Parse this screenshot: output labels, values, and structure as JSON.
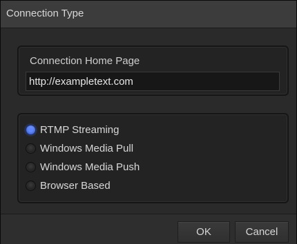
{
  "dialog": {
    "title": "Connection Type"
  },
  "home_page": {
    "label": "Connection Home Page",
    "url_value": "http://exampletext.com"
  },
  "connection_types": {
    "options": [
      {
        "label": "RTMP Streaming",
        "selected": true
      },
      {
        "label": "Windows Media Pull",
        "selected": false
      },
      {
        "label": "Windows Media Push",
        "selected": false
      },
      {
        "label": "Browser Based",
        "selected": false
      }
    ]
  },
  "buttons": {
    "ok_label": "OK",
    "cancel_label": "Cancel"
  },
  "colors": {
    "accent": "#5f86ff",
    "background": "#2a2a2a"
  }
}
